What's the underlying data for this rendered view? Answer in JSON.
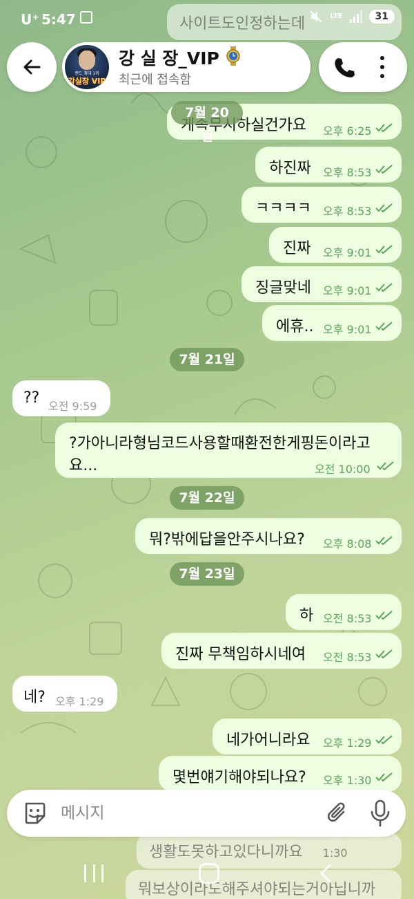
{
  "status_bar": {
    "carrier": "U⁺",
    "time": "5:47",
    "network": "LTE",
    "battery": "31"
  },
  "ghost_messages": [
    "사이트도인정하는데",
    "생활도못하고있다니까요",
    "1:30",
    "뭐보상이라도해주셔야되는거아닙니까"
  ],
  "header": {
    "contact_name": "강 실 장_VIP",
    "contact_status": "최근에 접속함",
    "avatar_text_small": "랜드 최대 1위",
    "avatar_text": "강실장 VIP"
  },
  "messages": [
    {
      "type": "out",
      "text": "게속무시하실건가요",
      "time": "오후 6:25"
    },
    {
      "type": "date",
      "text": "7월 20일"
    },
    {
      "type": "out",
      "text": "하진짜",
      "time": "오후 8:53"
    },
    {
      "type": "out",
      "text": "ㅋㅋㅋㅋ",
      "time": "오후 8:53"
    },
    {
      "type": "out",
      "text": "진짜",
      "time": "오후 9:01"
    },
    {
      "type": "out",
      "text": "징글맞네",
      "time": "오후 9:01"
    },
    {
      "type": "out",
      "text": "에휴..",
      "time": "오후 9:01"
    },
    {
      "type": "date",
      "text": "7월 21일"
    },
    {
      "type": "in",
      "text": "??",
      "time": "오전 9:59"
    },
    {
      "type": "out",
      "text_line1": "?가아니라형님코드사용할때환전한게핑돈이라고",
      "text_line2": "요...",
      "time": "오전 10:00"
    },
    {
      "type": "date",
      "text": "7월 22일"
    },
    {
      "type": "out",
      "text": "뭐?밖에답을안주시나요?",
      "time": "오후 8:08"
    },
    {
      "type": "date",
      "text": "7월 23일"
    },
    {
      "type": "out",
      "text": "하",
      "time": "오전 8:53"
    },
    {
      "type": "out",
      "text": "진짜 무책임하시네여",
      "time": "오전 8:53"
    },
    {
      "type": "in",
      "text": "네?",
      "time": "오후 1:29"
    },
    {
      "type": "out",
      "text": "네가어니라요",
      "time": "오후 1:29"
    },
    {
      "type": "out",
      "text": "몇번얘기해야되나요?",
      "time": "오후 1:30"
    }
  ],
  "input": {
    "placeholder": "메시지"
  },
  "icons": {
    "back": "arrow-left-icon",
    "call": "phone-icon",
    "more": "more-vertical-icon",
    "sticker": "sticker-icon",
    "attach": "paperclip-icon",
    "mic": "microphone-icon",
    "read": "double-check-icon"
  },
  "colors": {
    "outgoing_bubble": "#eefee0",
    "incoming_bubble": "#ffffff",
    "time_outgoing": "#5aa35a",
    "date_pill": "#6e965a"
  }
}
